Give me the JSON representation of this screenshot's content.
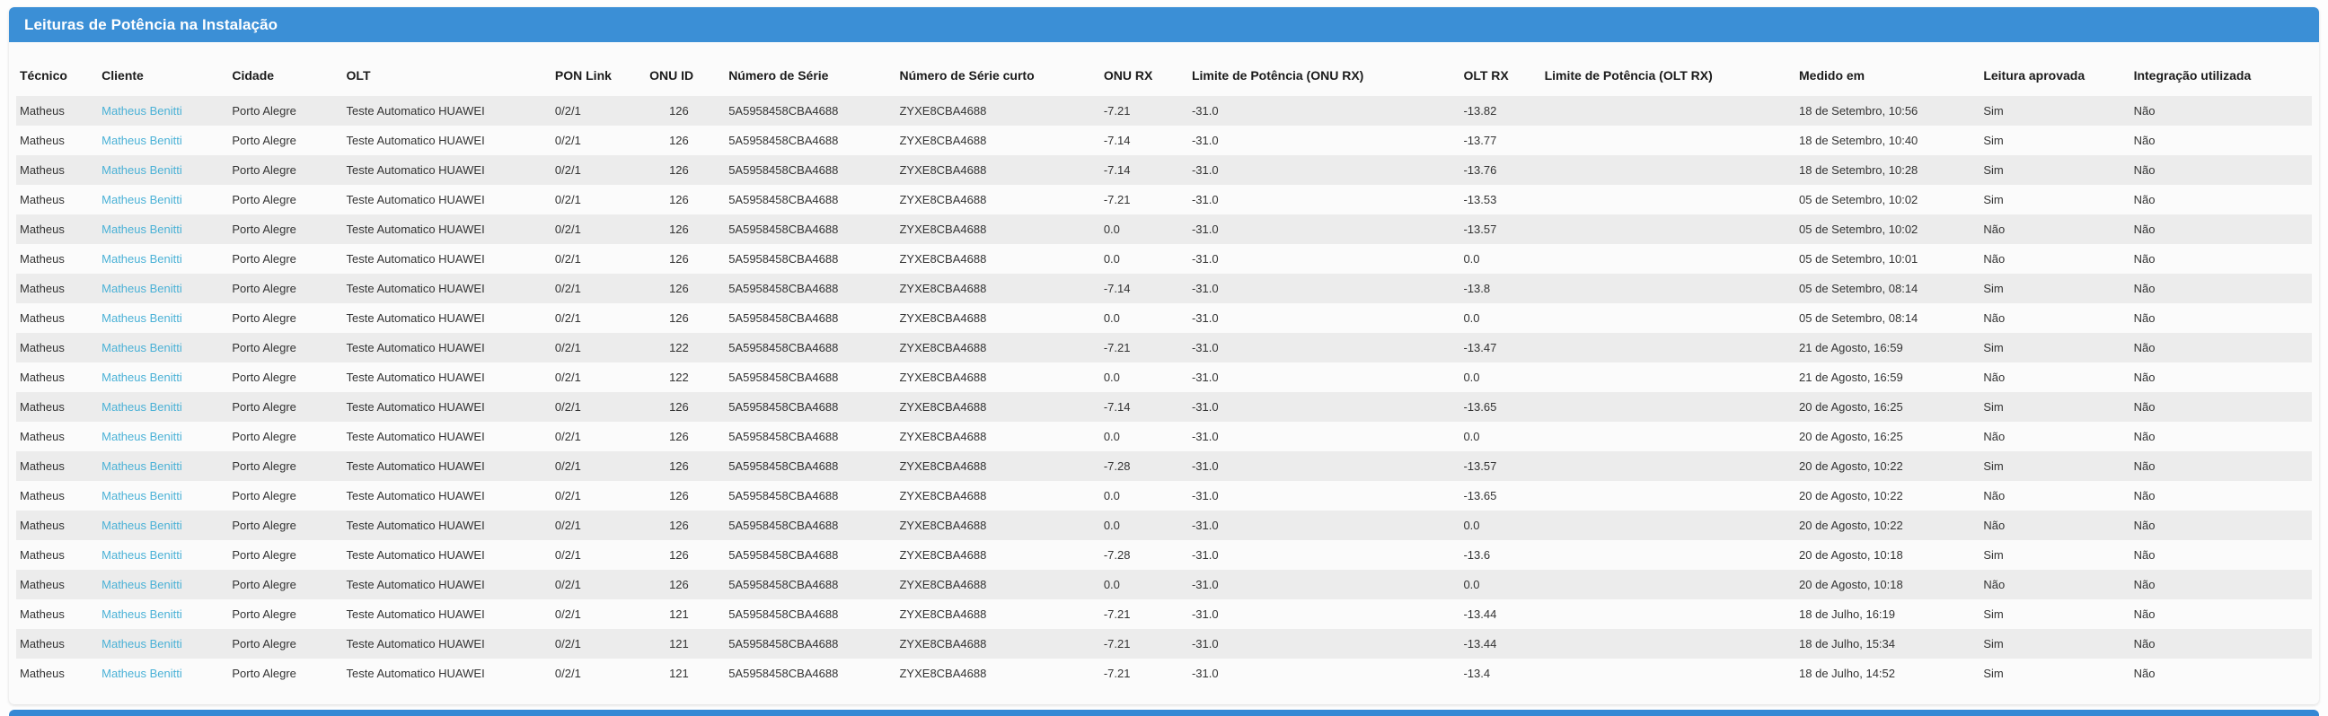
{
  "panel": {
    "title": "Leituras de Potência na Instalação"
  },
  "colors": {
    "panel_header_blue": "#3b8fd6",
    "client_link_blue": "#4ab1d6",
    "row_stripe_gray": "#ececec"
  },
  "table": {
    "columns": [
      {
        "key": "tecnico",
        "label": "Técnico"
      },
      {
        "key": "cliente",
        "label": "Cliente"
      },
      {
        "key": "cidade",
        "label": "Cidade"
      },
      {
        "key": "olt",
        "label": "OLT"
      },
      {
        "key": "pon_link",
        "label": "PON Link"
      },
      {
        "key": "onu_id",
        "label": "ONU ID"
      },
      {
        "key": "numero_serie",
        "label": "Número de Série"
      },
      {
        "key": "numero_serie_curto",
        "label": "Número de Série curto"
      },
      {
        "key": "onu_rx",
        "label": "ONU RX"
      },
      {
        "key": "limite_potencia_onu_rx",
        "label": "Limite de Potência (ONU RX)"
      },
      {
        "key": "olt_rx",
        "label": "OLT RX"
      },
      {
        "key": "limite_potencia_olt_rx",
        "label": "Limite de Potência (OLT RX)"
      },
      {
        "key": "medido_em",
        "label": "Medido em"
      },
      {
        "key": "leitura_aprovada",
        "label": "Leitura aprovada"
      },
      {
        "key": "integracao_utilizada",
        "label": "Integração utilizada"
      }
    ],
    "rows": [
      [
        "Matheus",
        "Matheus Benitti",
        "Porto Alegre",
        "Teste Automatico HUAWEI",
        "0/2/1",
        "126",
        "5A5958458CBA4688",
        "ZYXE8CBA4688",
        "-7.21",
        "-31.0",
        "-13.82",
        "",
        "18 de Setembro, 10:56",
        "Sim",
        "Não"
      ],
      [
        "Matheus",
        "Matheus Benitti",
        "Porto Alegre",
        "Teste Automatico HUAWEI",
        "0/2/1",
        "126",
        "5A5958458CBA4688",
        "ZYXE8CBA4688",
        "-7.14",
        "-31.0",
        "-13.77",
        "",
        "18 de Setembro, 10:40",
        "Sim",
        "Não"
      ],
      [
        "Matheus",
        "Matheus Benitti",
        "Porto Alegre",
        "Teste Automatico HUAWEI",
        "0/2/1",
        "126",
        "5A5958458CBA4688",
        "ZYXE8CBA4688",
        "-7.14",
        "-31.0",
        "-13.76",
        "",
        "18 de Setembro, 10:28",
        "Sim",
        "Não"
      ],
      [
        "Matheus",
        "Matheus Benitti",
        "Porto Alegre",
        "Teste Automatico HUAWEI",
        "0/2/1",
        "126",
        "5A5958458CBA4688",
        "ZYXE8CBA4688",
        "-7.21",
        "-31.0",
        "-13.53",
        "",
        "05 de Setembro, 10:02",
        "Sim",
        "Não"
      ],
      [
        "Matheus",
        "Matheus Benitti",
        "Porto Alegre",
        "Teste Automatico HUAWEI",
        "0/2/1",
        "126",
        "5A5958458CBA4688",
        "ZYXE8CBA4688",
        "0.0",
        "-31.0",
        "-13.57",
        "",
        "05 de Setembro, 10:02",
        "Não",
        "Não"
      ],
      [
        "Matheus",
        "Matheus Benitti",
        "Porto Alegre",
        "Teste Automatico HUAWEI",
        "0/2/1",
        "126",
        "5A5958458CBA4688",
        "ZYXE8CBA4688",
        "0.0",
        "-31.0",
        "0.0",
        "",
        "05 de Setembro, 10:01",
        "Não",
        "Não"
      ],
      [
        "Matheus",
        "Matheus Benitti",
        "Porto Alegre",
        "Teste Automatico HUAWEI",
        "0/2/1",
        "126",
        "5A5958458CBA4688",
        "ZYXE8CBA4688",
        "-7.14",
        "-31.0",
        "-13.8",
        "",
        "05 de Setembro, 08:14",
        "Sim",
        "Não"
      ],
      [
        "Matheus",
        "Matheus Benitti",
        "Porto Alegre",
        "Teste Automatico HUAWEI",
        "0/2/1",
        "126",
        "5A5958458CBA4688",
        "ZYXE8CBA4688",
        "0.0",
        "-31.0",
        "0.0",
        "",
        "05 de Setembro, 08:14",
        "Não",
        "Não"
      ],
      [
        "Matheus",
        "Matheus Benitti",
        "Porto Alegre",
        "Teste Automatico HUAWEI",
        "0/2/1",
        "122",
        "5A5958458CBA4688",
        "ZYXE8CBA4688",
        "-7.21",
        "-31.0",
        "-13.47",
        "",
        "21 de Agosto, 16:59",
        "Sim",
        "Não"
      ],
      [
        "Matheus",
        "Matheus Benitti",
        "Porto Alegre",
        "Teste Automatico HUAWEI",
        "0/2/1",
        "122",
        "5A5958458CBA4688",
        "ZYXE8CBA4688",
        "0.0",
        "-31.0",
        "0.0",
        "",
        "21 de Agosto, 16:59",
        "Não",
        "Não"
      ],
      [
        "Matheus",
        "Matheus Benitti",
        "Porto Alegre",
        "Teste Automatico HUAWEI",
        "0/2/1",
        "126",
        "5A5958458CBA4688",
        "ZYXE8CBA4688",
        "-7.14",
        "-31.0",
        "-13.65",
        "",
        "20 de Agosto, 16:25",
        "Sim",
        "Não"
      ],
      [
        "Matheus",
        "Matheus Benitti",
        "Porto Alegre",
        "Teste Automatico HUAWEI",
        "0/2/1",
        "126",
        "5A5958458CBA4688",
        "ZYXE8CBA4688",
        "0.0",
        "-31.0",
        "0.0",
        "",
        "20 de Agosto, 16:25",
        "Não",
        "Não"
      ],
      [
        "Matheus",
        "Matheus Benitti",
        "Porto Alegre",
        "Teste Automatico HUAWEI",
        "0/2/1",
        "126",
        "5A5958458CBA4688",
        "ZYXE8CBA4688",
        "-7.28",
        "-31.0",
        "-13.57",
        "",
        "20 de Agosto, 10:22",
        "Sim",
        "Não"
      ],
      [
        "Matheus",
        "Matheus Benitti",
        "Porto Alegre",
        "Teste Automatico HUAWEI",
        "0/2/1",
        "126",
        "5A5958458CBA4688",
        "ZYXE8CBA4688",
        "0.0",
        "-31.0",
        "-13.65",
        "",
        "20 de Agosto, 10:22",
        "Não",
        "Não"
      ],
      [
        "Matheus",
        "Matheus Benitti",
        "Porto Alegre",
        "Teste Automatico HUAWEI",
        "0/2/1",
        "126",
        "5A5958458CBA4688",
        "ZYXE8CBA4688",
        "0.0",
        "-31.0",
        "0.0",
        "",
        "20 de Agosto, 10:22",
        "Não",
        "Não"
      ],
      [
        "Matheus",
        "Matheus Benitti",
        "Porto Alegre",
        "Teste Automatico HUAWEI",
        "0/2/1",
        "126",
        "5A5958458CBA4688",
        "ZYXE8CBA4688",
        "-7.28",
        "-31.0",
        "-13.6",
        "",
        "20 de Agosto, 10:18",
        "Sim",
        "Não"
      ],
      [
        "Matheus",
        "Matheus Benitti",
        "Porto Alegre",
        "Teste Automatico HUAWEI",
        "0/2/1",
        "126",
        "5A5958458CBA4688",
        "ZYXE8CBA4688",
        "0.0",
        "-31.0",
        "0.0",
        "",
        "20 de Agosto, 10:18",
        "Não",
        "Não"
      ],
      [
        "Matheus",
        "Matheus Benitti",
        "Porto Alegre",
        "Teste Automatico HUAWEI",
        "0/2/1",
        "121",
        "5A5958458CBA4688",
        "ZYXE8CBA4688",
        "-7.21",
        "-31.0",
        "-13.44",
        "",
        "18 de Julho, 16:19",
        "Sim",
        "Não"
      ],
      [
        "Matheus",
        "Matheus Benitti",
        "Porto Alegre",
        "Teste Automatico HUAWEI",
        "0/2/1",
        "121",
        "5A5958458CBA4688",
        "ZYXE8CBA4688",
        "-7.21",
        "-31.0",
        "-13.44",
        "",
        "18 de Julho, 15:34",
        "Sim",
        "Não"
      ],
      [
        "Matheus",
        "Matheus Benitti",
        "Porto Alegre",
        "Teste Automatico HUAWEI",
        "0/2/1",
        "121",
        "5A5958458CBA4688",
        "ZYXE8CBA4688",
        "-7.21",
        "-31.0",
        "-13.4",
        "",
        "18 de Julho, 14:52",
        "Sim",
        "Não"
      ]
    ]
  }
}
